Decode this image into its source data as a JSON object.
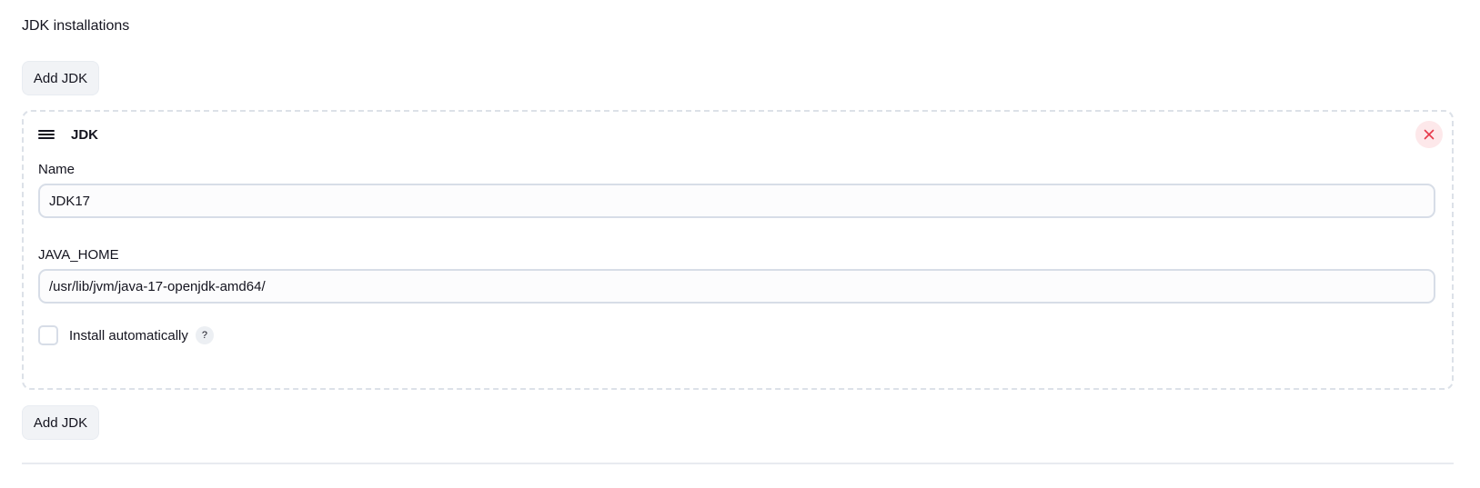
{
  "section": {
    "title": "JDK installations"
  },
  "buttons": {
    "add_jdk_top": "Add JDK",
    "add_jdk_bottom": "Add JDK"
  },
  "jdk_entry": {
    "title": "JDK",
    "name_label": "Name",
    "name_value": "JDK17",
    "java_home_label": "JAVA_HOME",
    "java_home_value": "/usr/lib/jvm/java-17-openjdk-amd64/",
    "install_automatically_label": "Install automatically",
    "install_automatically_checked": false,
    "help_glyph": "?"
  },
  "icons": {
    "drag_handle": "drag-handle-icon",
    "delete": "close-icon",
    "help": "help-icon"
  },
  "colors": {
    "delete_icon": "#e6394a",
    "delete_bg": "#fde8ea",
    "border_dashed": "#dce1e8",
    "button_bg": "#f1f3f6"
  }
}
